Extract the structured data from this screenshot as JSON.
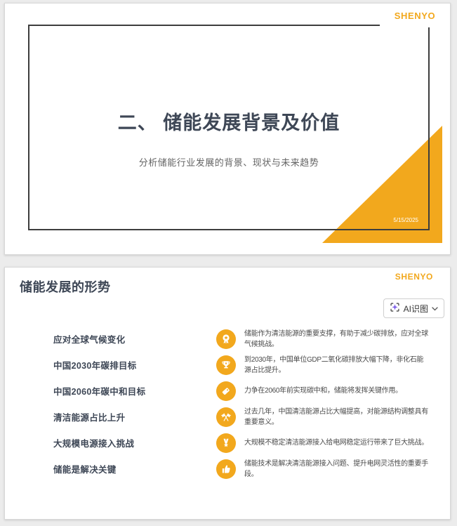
{
  "brand": {
    "name": "SHENYO",
    "color": "#F2A81D"
  },
  "colors": {
    "accent_orange": "#F2A81D",
    "title_dark": "#3E4756",
    "ai_icon_purple": "#7B5BE8"
  },
  "slide1": {
    "title": "二、 储能发展背景及价值",
    "subtitle": "分析储能行业发展的背景、现状与未来趋势",
    "date": "5/15/2025"
  },
  "slide2": {
    "title": "储能发展的形势",
    "ai_button": {
      "label": "AI识图",
      "icon": "scan-sparkle-icon",
      "chevron": "chevron-down-icon"
    },
    "rows": [
      {
        "label": "应对全球气候变化",
        "icon": "award-medal-icon",
        "desc": "储能作为清洁能源的重要支撑，有助于减少碳排放，应对全球气候挑战。"
      },
      {
        "label": "中国2030年碳排目标",
        "icon": "trophy-icon",
        "desc": "到2030年，中国单位GDP二氧化碳排放大幅下降，非化石能源占比提升。"
      },
      {
        "label": "中国2060年碳中和目标",
        "icon": "tag-icon",
        "desc": "力争在2060年前实现碳中和，储能将发挥关键作用。"
      },
      {
        "label": "清洁能源占比上升",
        "icon": "crossed-flags-icon",
        "desc": "过去几年，中国清洁能源占比大幅提高，对能源结构调整具有重要意义。"
      },
      {
        "label": "大规模电源接入挑战",
        "icon": "medal-star-icon",
        "desc": "大规模不稳定清洁能源接入给电网稳定运行带来了巨大挑战。"
      },
      {
        "label": "储能是解决关键",
        "icon": "thumbs-up-icon",
        "desc": "储能技术是解决清洁能源接入问题、提升电网灵活性的重要手段。"
      }
    ]
  }
}
